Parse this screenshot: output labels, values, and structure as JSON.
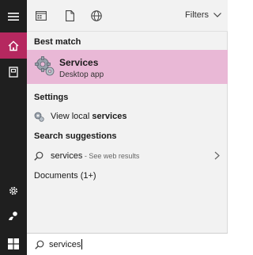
{
  "toolbar": {
    "filters_label": "Filters"
  },
  "sections": {
    "best_match": "Best match",
    "settings": "Settings",
    "search_suggestions": "Search suggestions",
    "documents": "Documents (1+)"
  },
  "best_match": {
    "title": "Services",
    "subtitle": "Desktop app"
  },
  "settings_item": {
    "prefix": "View local ",
    "bold": "services"
  },
  "suggestion": {
    "term": "services",
    "hint": " - See web results"
  },
  "search": {
    "value": "services"
  },
  "colors": {
    "accent": "#b5285f",
    "highlight": "#e9b8d6",
    "rail": "#1f1f1f"
  }
}
